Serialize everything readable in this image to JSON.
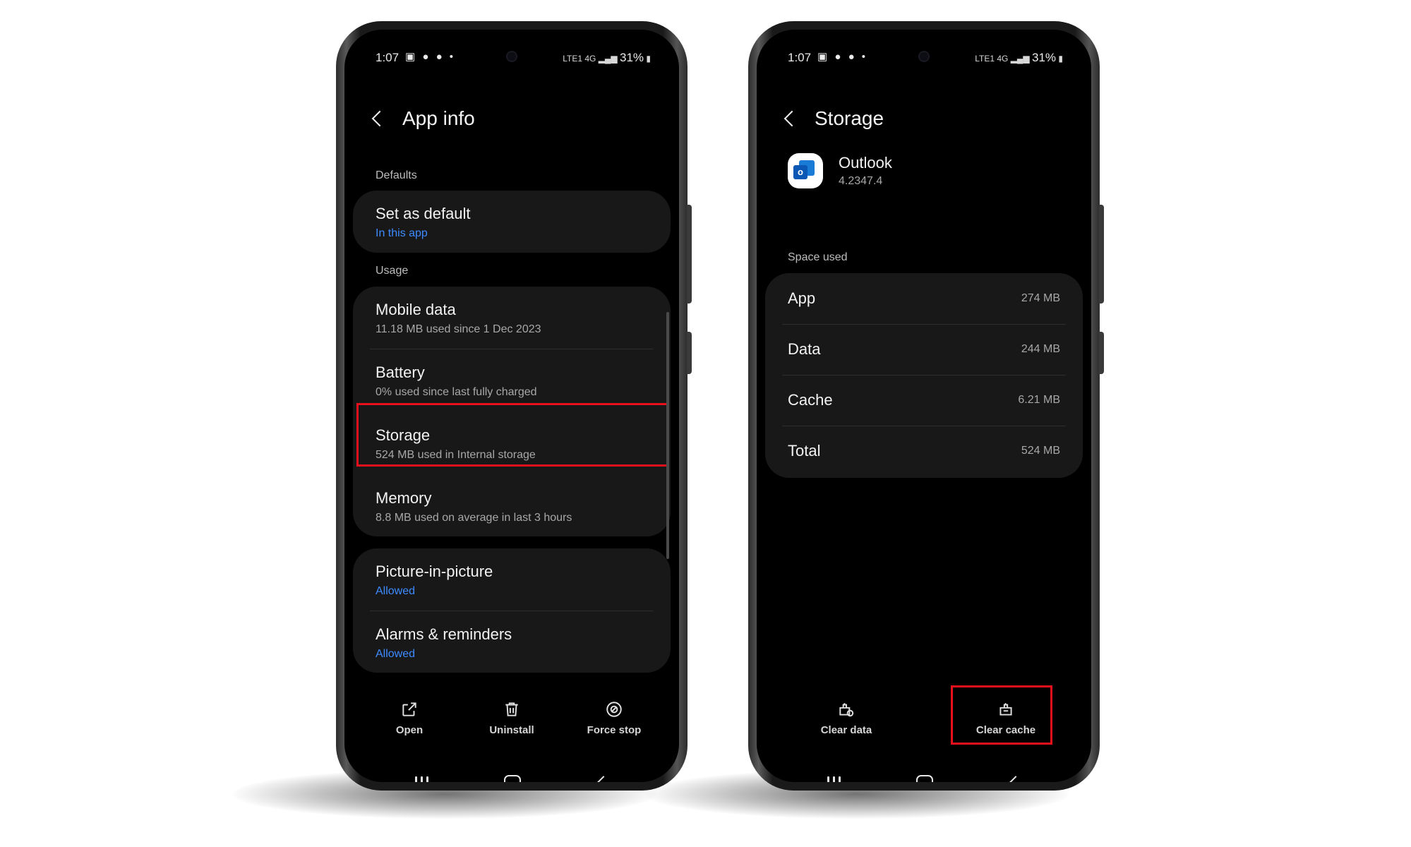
{
  "status": {
    "time": "1:07",
    "notifications": "▣ ● ● •",
    "network": "LTE1 4G",
    "battery": "31%"
  },
  "left_phone": {
    "title": "App info",
    "sections": {
      "defaults": "Defaults",
      "usage": "Usage"
    },
    "default_item": {
      "title": "Set as default",
      "subtitle": "In this app"
    },
    "usage_items": [
      {
        "title": "Mobile data",
        "subtitle": "11.18 MB used since 1 Dec 2023"
      },
      {
        "title": "Battery",
        "subtitle": "0% used since last fully charged"
      },
      {
        "title": "Storage",
        "subtitle": "524 MB used in Internal storage"
      },
      {
        "title": "Memory",
        "subtitle": "8.8 MB used on average in last 3 hours"
      }
    ],
    "permission_items": [
      {
        "title": "Picture-in-picture",
        "subtitle": "Allowed"
      },
      {
        "title": "Alarms & reminders",
        "subtitle": "Allowed"
      }
    ],
    "actions": {
      "open": "Open",
      "uninstall": "Uninstall",
      "force_stop": "Force stop"
    }
  },
  "right_phone": {
    "title": "Storage",
    "app": {
      "name": "Outlook",
      "version": "4.2347.4"
    },
    "space_used_label": "Space used",
    "space": [
      {
        "label": "App",
        "value": "274 MB"
      },
      {
        "label": "Data",
        "value": "244 MB"
      },
      {
        "label": "Cache",
        "value": "6.21 MB"
      },
      {
        "label": "Total",
        "value": "524 MB"
      }
    ],
    "actions": {
      "clear_data": "Clear data",
      "clear_cache": "Clear cache"
    }
  },
  "colors": {
    "highlight": "#e8101a",
    "link_blue": "#3d8bff",
    "card": "#181818"
  }
}
